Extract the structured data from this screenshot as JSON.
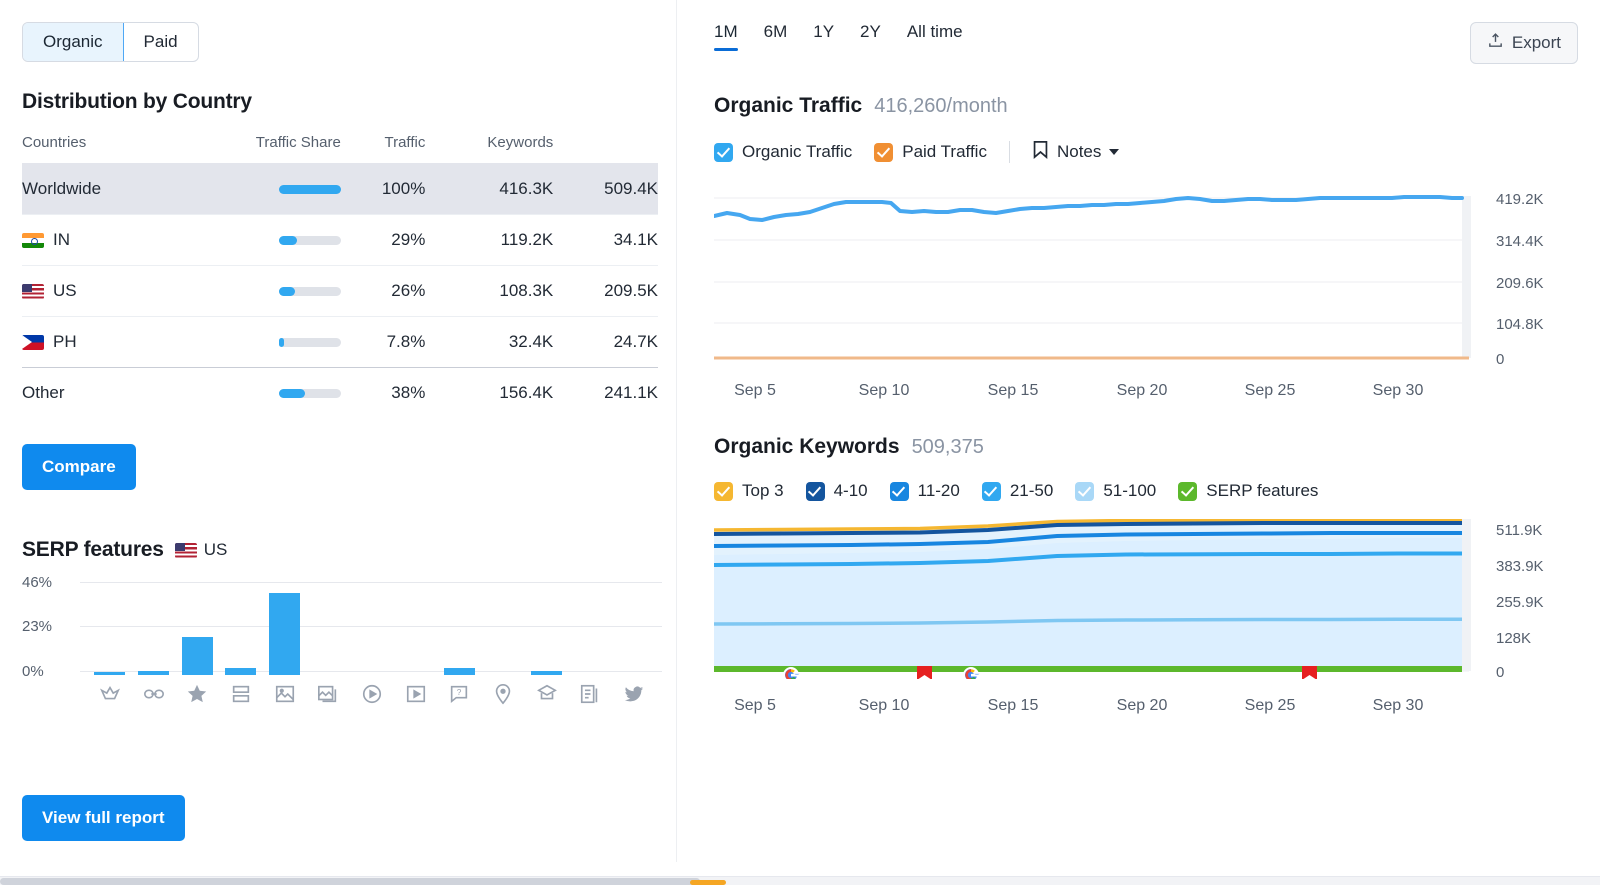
{
  "toggle": {
    "organic": "Organic",
    "paid": "Paid"
  },
  "distribution": {
    "title": "Distribution by Country",
    "columns": [
      "Countries",
      "Traffic Share",
      "Traffic",
      "Keywords"
    ],
    "rows": [
      {
        "country": "Worldwide",
        "flag": "none",
        "share_pct": 100,
        "share_label": "100%",
        "traffic": "416.3K",
        "keywords": "509.4K",
        "highlight": true,
        "linked": false
      },
      {
        "country": "IN",
        "flag": "in",
        "share_pct": 29,
        "share_label": "29%",
        "traffic": "119.2K",
        "keywords": "34.1K",
        "highlight": false,
        "linked": true
      },
      {
        "country": "US",
        "flag": "us",
        "share_pct": 26,
        "share_label": "26%",
        "traffic": "108.3K",
        "keywords": "209.5K",
        "highlight": false,
        "linked": true
      },
      {
        "country": "PH",
        "flag": "ph",
        "share_pct": 7.8,
        "share_label": "7.8%",
        "traffic": "32.4K",
        "keywords": "24.7K",
        "highlight": false,
        "linked": true
      },
      {
        "country": "Other",
        "flag": "none",
        "share_pct": 38,
        "share_label": "38%",
        "traffic": "156.4K",
        "keywords": "241.1K",
        "highlight": false,
        "linked": false
      }
    ],
    "compare_button": "Compare"
  },
  "serp": {
    "title": "SERP features",
    "country": "US",
    "view_report_button": "View full report"
  },
  "timeranges": {
    "items": [
      "1M",
      "6M",
      "1Y",
      "2Y",
      "All time"
    ],
    "selected": "1M"
  },
  "export_button": "Export",
  "organic_traffic": {
    "title": "Organic Traffic",
    "value": "416,260/month",
    "legend": [
      {
        "label": "Organic Traffic",
        "color": "#31a8f0",
        "checked": true
      },
      {
        "label": "Paid Traffic",
        "color": "#f08f33",
        "checked": true
      }
    ],
    "notes_label": "Notes"
  },
  "organic_keywords": {
    "title": "Organic Keywords",
    "value": "509,375",
    "legend": [
      {
        "label": "Top 3",
        "color": "#f5b731",
        "checked": true
      },
      {
        "label": "4-10",
        "color": "#14559e",
        "checked": true
      },
      {
        "label": "11-20",
        "color": "#1886e0",
        "checked": true
      },
      {
        "label": "21-50",
        "color": "#31a8f0",
        "checked": true
      },
      {
        "label": "51-100",
        "color": "#a9d8f7",
        "checked": true
      },
      {
        "label": "SERP features",
        "color": "#5cb82c",
        "checked": true
      }
    ]
  },
  "chart_data": [
    {
      "type": "bar",
      "title": "SERP features",
      "xlabel": "",
      "ylabel": "",
      "ylim": [
        0,
        46
      ],
      "yticks": [
        0,
        23,
        46
      ],
      "ytick_labels": [
        "0%",
        "23%",
        "46%"
      ],
      "categories": [
        "featured-snippet",
        "sitelinks",
        "reviews",
        "hotels-pack",
        "image-pack",
        "images",
        "video",
        "video-carousel",
        "people-also-ask",
        "local-pack",
        "knowledge-panel",
        "instant-answer",
        "twitter"
      ],
      "values": [
        1.2,
        1.5,
        19,
        3.2,
        41,
        0,
        0,
        0,
        3.2,
        0,
        1.5,
        0,
        0
      ],
      "grid": true,
      "legend": "none"
    },
    {
      "type": "line",
      "title": "Organic Traffic",
      "xlabel": "",
      "ylabel": "",
      "ylim": [
        0,
        419200
      ],
      "yticks": [
        0,
        104800,
        209600,
        314400,
        419200
      ],
      "ytick_labels": [
        "0",
        "104.8K",
        "209.6K",
        "314.4K",
        "419.2K"
      ],
      "xtick_labels": [
        "Sep 5",
        "Sep 10",
        "Sep 15",
        "Sep 20",
        "Sep 25",
        "Sep 30"
      ],
      "series": [
        {
          "name": "Organic Traffic",
          "color": "#31a8f0",
          "values": [
            366000,
            372000,
            360000,
            356000,
            362000,
            368000,
            374000,
            392000,
            409000,
            411000,
            411000,
            411000,
            410000,
            385000,
            383000,
            384000,
            383000,
            382000,
            389000,
            387000,
            381000,
            386000,
            390000,
            394000,
            392000,
            396000,
            399000,
            398000,
            400000,
            402000,
            404000,
            408000,
            413000,
            409000,
            408000,
            412000,
            409000,
            407000,
            410000,
            412000,
            413000,
            416260
          ]
        },
        {
          "name": "Paid Traffic",
          "color": "#f0b98a",
          "values": [
            0,
            0,
            0,
            0,
            0,
            0,
            0,
            0,
            0,
            0,
            0,
            0,
            0,
            0,
            0,
            0,
            0,
            0,
            0,
            0,
            0,
            0,
            0,
            0,
            0,
            0,
            0,
            0,
            0,
            0,
            0,
            0,
            0,
            0,
            0,
            0,
            0,
            0,
            0,
            0,
            0,
            0
          ]
        }
      ],
      "grid": true
    },
    {
      "type": "area",
      "title": "Organic Keywords",
      "xlabel": "",
      "ylabel": "",
      "ylim": [
        0,
        511900
      ],
      "yticks": [
        0,
        128000,
        255900,
        383900,
        511900
      ],
      "ytick_labels": [
        "0",
        "128K",
        "255.9K",
        "383.9K",
        "511.9K"
      ],
      "xtick_labels": [
        "Sep 5",
        "Sep 10",
        "Sep 15",
        "Sep 20",
        "Sep 25",
        "Sep 30"
      ],
      "series": [
        {
          "name": "Top 3",
          "color": "#f5b731",
          "values": [
            482000,
            483000,
            484000,
            486000,
            489000,
            497000,
            503000,
            505000,
            506000,
            507000,
            508000,
            509375
          ]
        },
        {
          "name": "4-10",
          "color": "#14559e",
          "values": [
            474000,
            475000,
            476000,
            478000,
            482000,
            491000,
            496000,
            498000,
            499000,
            500000,
            501000,
            502000
          ]
        },
        {
          "name": "11-20",
          "color": "#1886e0",
          "values": [
            443000,
            444000,
            445000,
            447000,
            452000,
            461000,
            466000,
            468000,
            469000,
            470000,
            471000,
            472000
          ]
        },
        {
          "name": "21-50",
          "color": "#31a8f0",
          "values": [
            389000,
            390000,
            391000,
            394000,
            400000,
            412000,
            416000,
            418000,
            419000,
            420000,
            421000,
            422000
          ]
        },
        {
          "name": "51-100",
          "color": "#a9d8f7",
          "values": [
            168000,
            169000,
            170000,
            171000,
            173000,
            177000,
            179000,
            180000,
            181000,
            181500,
            182000,
            182500
          ]
        },
        {
          "name": "SERP features",
          "color": "#5cb82c",
          "values": [
            8000,
            8000,
            8000,
            8000,
            8000,
            8000,
            8000,
            8000,
            8000,
            8000,
            8000,
            8000
          ]
        }
      ],
      "annotations": [
        {
          "kind": "google-update",
          "x_label": "Sep 6"
        },
        {
          "kind": "note",
          "x_label": "Sep 10"
        },
        {
          "kind": "google-update",
          "x_label": "Sep 13"
        },
        {
          "kind": "note",
          "x_label": "Sep 25"
        }
      ],
      "grid": true
    }
  ]
}
